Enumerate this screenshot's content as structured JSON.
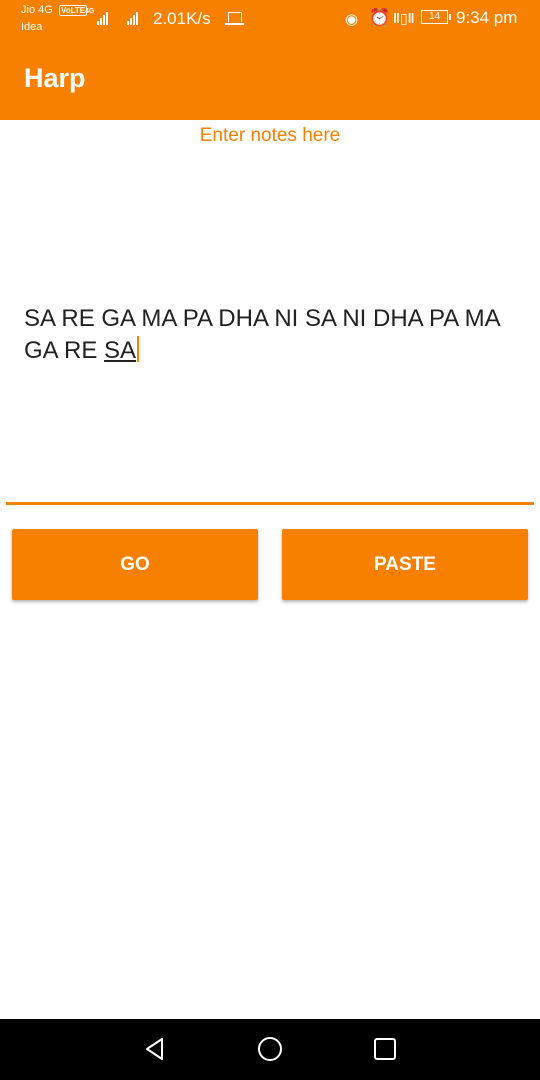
{
  "statusbar": {
    "carrier1": "Jio 4G",
    "carrier2": "Idea",
    "volte": "VoLTE",
    "network": "4G",
    "speed": "2.01K/s",
    "battery": "14",
    "time": "9:34 pm",
    "icons": [
      "eye-icon",
      "alarm-icon",
      "vibrate-icon",
      "battery-icon",
      "laptop-icon",
      "signal-icon"
    ]
  },
  "appbar": {
    "title": "Harp"
  },
  "editor": {
    "hint": "Enter notes here",
    "value_main": "SA RE GA MA PA DHA NI SA NI DHA PA MA GA RE ",
    "value_last": "SA"
  },
  "buttons": {
    "go": "GO",
    "paste": "PASTE"
  },
  "colors": {
    "accent": "#f78000",
    "text": "#222222",
    "navbar": "#000000"
  },
  "navbar": {
    "icons": [
      "back-icon",
      "home-icon",
      "recents-icon"
    ]
  }
}
